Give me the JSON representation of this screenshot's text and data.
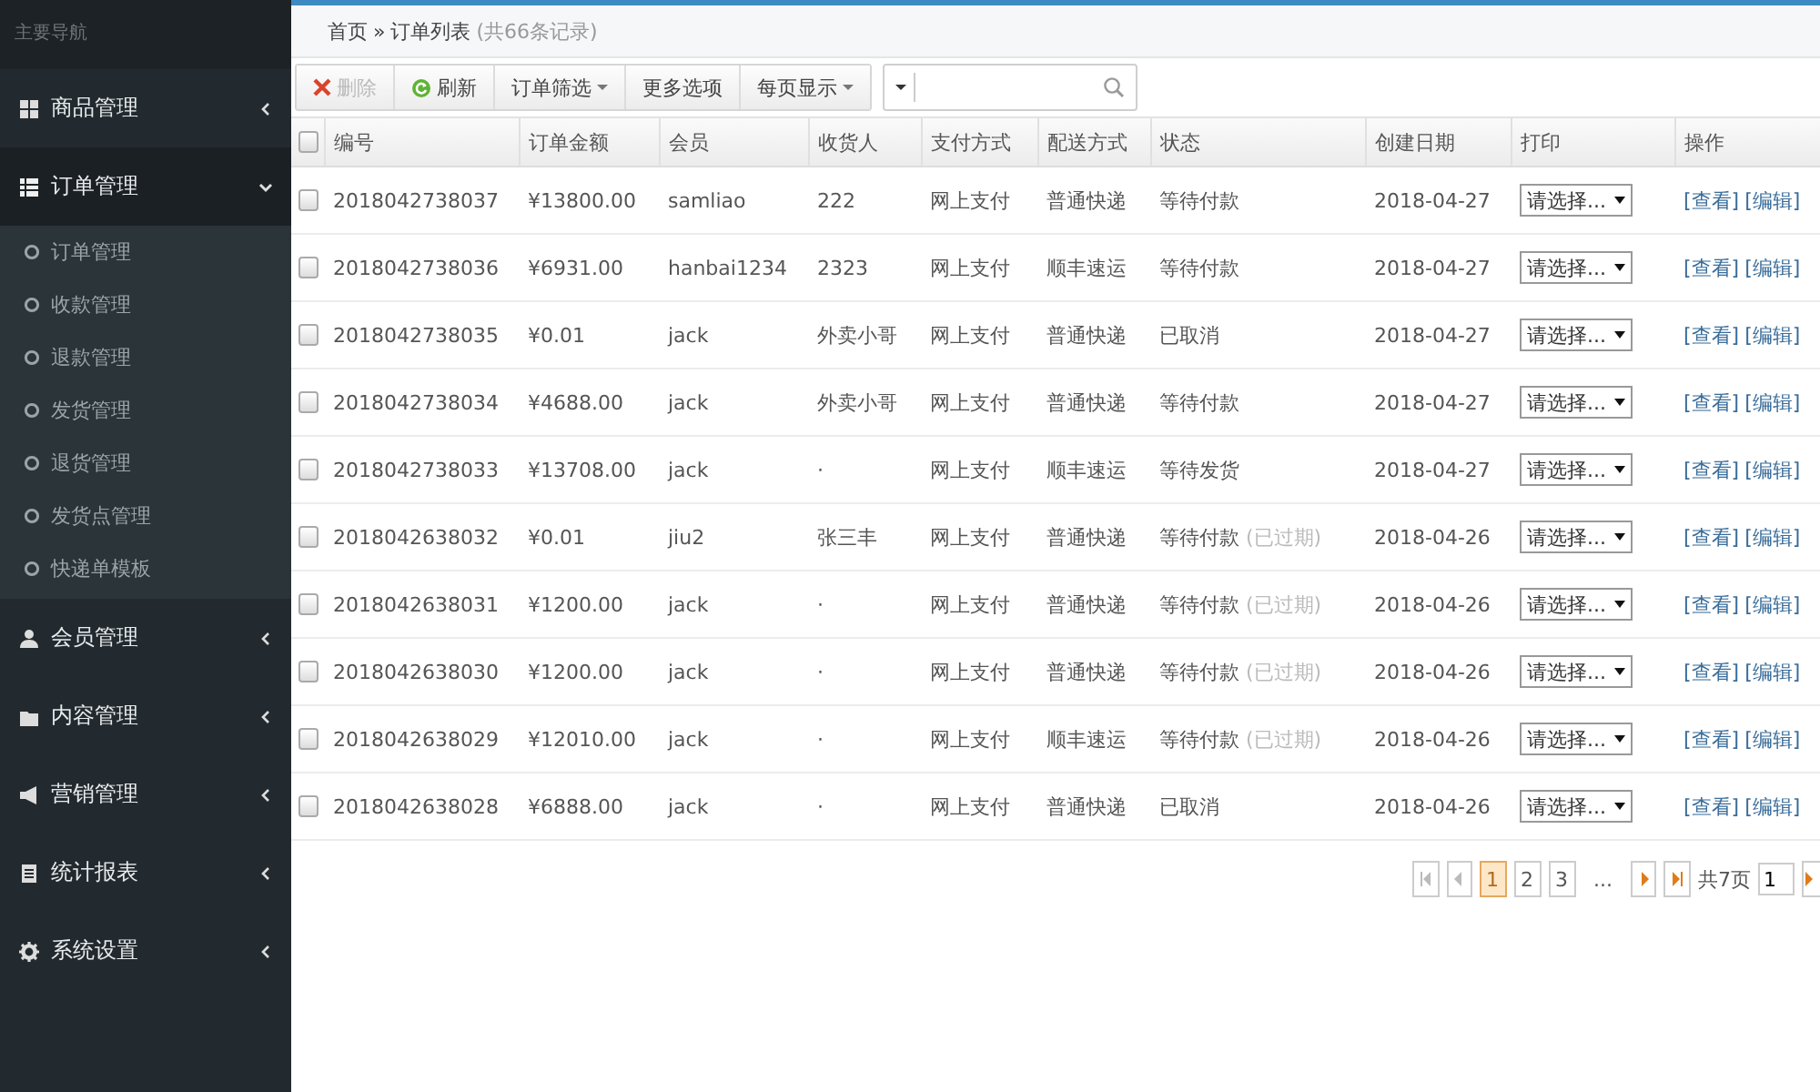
{
  "sidebar": {
    "title": "主要导航",
    "groups": [
      {
        "label": "商品管理",
        "expanded": false
      },
      {
        "label": "订单管理",
        "expanded": true,
        "children": [
          {
            "label": "订单管理"
          },
          {
            "label": "收款管理"
          },
          {
            "label": "退款管理"
          },
          {
            "label": "发货管理"
          },
          {
            "label": "退货管理"
          },
          {
            "label": "发货点管理"
          },
          {
            "label": "快递单模板"
          }
        ]
      },
      {
        "label": "会员管理",
        "expanded": false
      },
      {
        "label": "内容管理",
        "expanded": false
      },
      {
        "label": "营销管理",
        "expanded": false
      },
      {
        "label": "统计报表",
        "expanded": false
      },
      {
        "label": "系统设置",
        "expanded": false
      }
    ]
  },
  "breadcrumb": {
    "home": "首页",
    "separator": "»",
    "current": "订单列表",
    "count": "(共66条记录)"
  },
  "toolbar": {
    "buttons": [
      {
        "kind": "delete",
        "label": "删除",
        "disabled": true
      },
      {
        "kind": "refresh",
        "label": "刷新",
        "disabled": false
      },
      {
        "kind": "dropdown",
        "label": "订单筛选",
        "disabled": false
      },
      {
        "kind": "plain",
        "label": "更多选项",
        "disabled": false
      },
      {
        "kind": "dropdown",
        "label": "每页显示",
        "disabled": false
      }
    ]
  },
  "table": {
    "select_all_checked": false,
    "columns": [
      "编号",
      "订单金额",
      "会员",
      "收货人",
      "支付方式",
      "配送方式",
      "状态",
      "创建日期",
      "打印",
      "操作"
    ],
    "rows": [
      {
        "checked": false,
        "id": "2018042738037",
        "amount": "¥13800.00",
        "member": "samliao",
        "receiver": "222",
        "payment": "网上支付",
        "shipping": "普通快递",
        "status": "等待付款",
        "date": "2018-04-27",
        "print": "请选择...",
        "actions": [
          "[查看]",
          "[编辑]"
        ]
      },
      {
        "checked": false,
        "id": "2018042738036",
        "amount": "¥6931.00",
        "member": "hanbai1234",
        "receiver": "2323",
        "payment": "网上支付",
        "shipping": "顺丰速运",
        "status": "等待付款",
        "date": "2018-04-27",
        "print": "请选择...",
        "actions": [
          "[查看]",
          "[编辑]"
        ]
      },
      {
        "checked": false,
        "id": "2018042738035",
        "amount": "¥0.01",
        "member": "jack",
        "receiver": "外卖小哥",
        "payment": "网上支付",
        "shipping": "普通快递",
        "status": "已取消",
        "date": "2018-04-27",
        "print": "请选择...",
        "actions": [
          "[查看]",
          "[编辑]"
        ]
      },
      {
        "checked": false,
        "id": "2018042738034",
        "amount": "¥4688.00",
        "member": "jack",
        "receiver": "外卖小哥",
        "payment": "网上支付",
        "shipping": "普通快递",
        "status": "等待付款",
        "date": "2018-04-27",
        "print": "请选择...",
        "actions": [
          "[查看]",
          "[编辑]"
        ]
      },
      {
        "checked": false,
        "id": "2018042738033",
        "amount": "¥13708.00",
        "member": "jack",
        "receiver": "·",
        "payment": "网上支付",
        "shipping": "顺丰速运",
        "status": "等待发货",
        "date": "2018-04-27",
        "print": "请选择...",
        "actions": [
          "[查看]",
          "[编辑]"
        ]
      },
      {
        "checked": false,
        "id": "2018042638032",
        "amount": "¥0.01",
        "member": "jiu2",
        "receiver": "张三丰",
        "payment": "网上支付",
        "shipping": "普通快递",
        "status": "等待付款",
        "note": "(已过期)",
        "date": "2018-04-26",
        "print": "请选择...",
        "actions": [
          "[查看]",
          "[编辑]"
        ]
      },
      {
        "checked": false,
        "id": "2018042638031",
        "amount": "¥1200.00",
        "member": "jack",
        "receiver": "·",
        "payment": "网上支付",
        "shipping": "普通快递",
        "status": "等待付款",
        "note": "(已过期)",
        "date": "2018-04-26",
        "print": "请选择...",
        "actions": [
          "[查看]",
          "[编辑]"
        ]
      },
      {
        "checked": false,
        "id": "2018042638030",
        "amount": "¥1200.00",
        "member": "jack",
        "receiver": "·",
        "payment": "网上支付",
        "shipping": "普通快递",
        "status": "等待付款",
        "note": "(已过期)",
        "date": "2018-04-26",
        "print": "请选择...",
        "actions": [
          "[查看]",
          "[编辑]"
        ]
      },
      {
        "checked": false,
        "id": "2018042638029",
        "amount": "¥12010.00",
        "member": "jack",
        "receiver": "·",
        "payment": "网上支付",
        "shipping": "顺丰速运",
        "status": "等待付款",
        "note": "(已过期)",
        "date": "2018-04-26",
        "print": "请选择...",
        "actions": [
          "[查看]",
          "[编辑]"
        ]
      },
      {
        "checked": false,
        "id": "2018042638028",
        "amount": "¥6888.00",
        "member": "jack",
        "receiver": "·",
        "payment": "网上支付",
        "shipping": "普通快递",
        "status": "已取消",
        "date": "2018-04-26",
        "print": "请选择...",
        "actions": [
          "[查看]",
          "[编辑]"
        ]
      }
    ]
  },
  "pagination": {
    "pages": [
      {
        "label": "1",
        "selected": true
      },
      {
        "label": "2",
        "selected": false
      },
      {
        "label": "3",
        "selected": false
      }
    ],
    "ellipsis": "...",
    "total": "共7页",
    "page_input": "1"
  }
}
